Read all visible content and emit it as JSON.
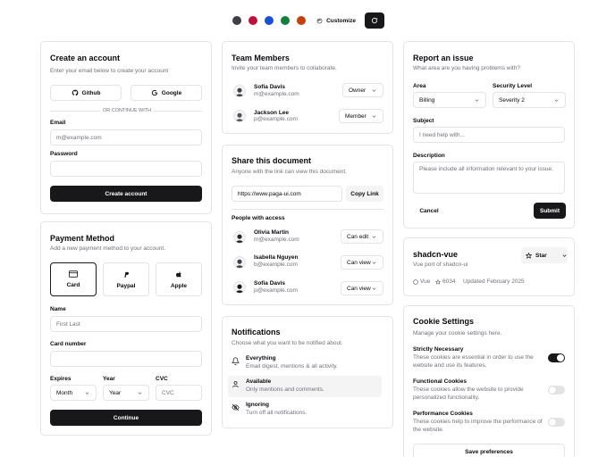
{
  "toolbar": {
    "swatches": [
      "#3f3f46",
      "#be123c",
      "#1d4ed8",
      "#15803d",
      "#c2410c"
    ],
    "customize_label": "Customize"
  },
  "create_account": {
    "title": "Create an account",
    "subtitle": "Enter your email below to create your account",
    "github_label": "Github",
    "google_label": "Google",
    "divider_text": "OR CONTINUE WITH",
    "email_label": "Email",
    "email_placeholder": "m@example.com",
    "password_label": "Password",
    "submit_label": "Create account"
  },
  "payment": {
    "title": "Payment Method",
    "subtitle": "Add a new payment method to your account.",
    "options": [
      "Card",
      "Paypal",
      "Apple"
    ],
    "name_label": "Name",
    "name_placeholder": "First Last",
    "card_label": "Card number",
    "expires_label": "Expires",
    "expires_value": "Month",
    "year_label": "Year",
    "year_value": "Year",
    "cvc_label": "CVC",
    "cvc_placeholder": "CVC",
    "submit_label": "Continue"
  },
  "team": {
    "title": "Team Members",
    "subtitle": "Invite your team members to collaborate.",
    "members": [
      {
        "name": "Sofia Davis",
        "email": "m@example.com",
        "role": "Owner"
      },
      {
        "name": "Jackson Lee",
        "email": "p@example.com",
        "role": "Member"
      }
    ]
  },
  "share": {
    "title": "Share this document",
    "subtitle": "Anyone with the link can view this document.",
    "link": "https://www.paga-ui.com",
    "copy_label": "Copy Link",
    "people_label": "People with access",
    "people": [
      {
        "name": "Olivia Martin",
        "email": "m@example.com",
        "perm": "Can edit"
      },
      {
        "name": "Isabella Nguyen",
        "email": "b@example.com",
        "perm": "Can view"
      },
      {
        "name": "Sofia Davis",
        "email": "p@example.com",
        "perm": "Can view"
      }
    ]
  },
  "notifications": {
    "title": "Notifications",
    "subtitle": "Choose what you want to be notified about.",
    "items": [
      {
        "title": "Everything",
        "desc": "Email digest, mentions & all activity."
      },
      {
        "title": "Available",
        "desc": "Only mentions and comments."
      },
      {
        "title": "Ignoring",
        "desc": "Turn off all notifications."
      }
    ]
  },
  "issue": {
    "title": "Report an issue",
    "subtitle": "What area are you having problems with?",
    "area_label": "Area",
    "area_value": "Billing",
    "severity_label": "Security Level",
    "severity_value": "Severity 2",
    "subject_label": "Subject",
    "subject_placeholder": "I need help with...",
    "desc_label": "Description",
    "desc_placeholder": "Please include all information relevant to your issue.",
    "cancel_label": "Cancel",
    "submit_label": "Submit"
  },
  "repo": {
    "title": "shadcn-vue",
    "subtitle": "Vue port of shadcn-ui",
    "star_label": "Star",
    "language": "Vue",
    "stars": "6034",
    "updated": "Updated February 2025"
  },
  "cookies": {
    "title": "Cookie Settings",
    "subtitle": "Manage your cookie settings here.",
    "items": [
      {
        "title": "Strictly Necessary",
        "desc": "These cookies are essential in order to use the website and use its features.",
        "on": true
      },
      {
        "title": "Functional Cookies",
        "desc": "These cookies allow the website to provide personalized functionality.",
        "on": false
      },
      {
        "title": "Performance Cookies",
        "desc": "These cookies help to improve the performance of the website.",
        "on": false
      }
    ],
    "save_label": "Save preferences"
  }
}
